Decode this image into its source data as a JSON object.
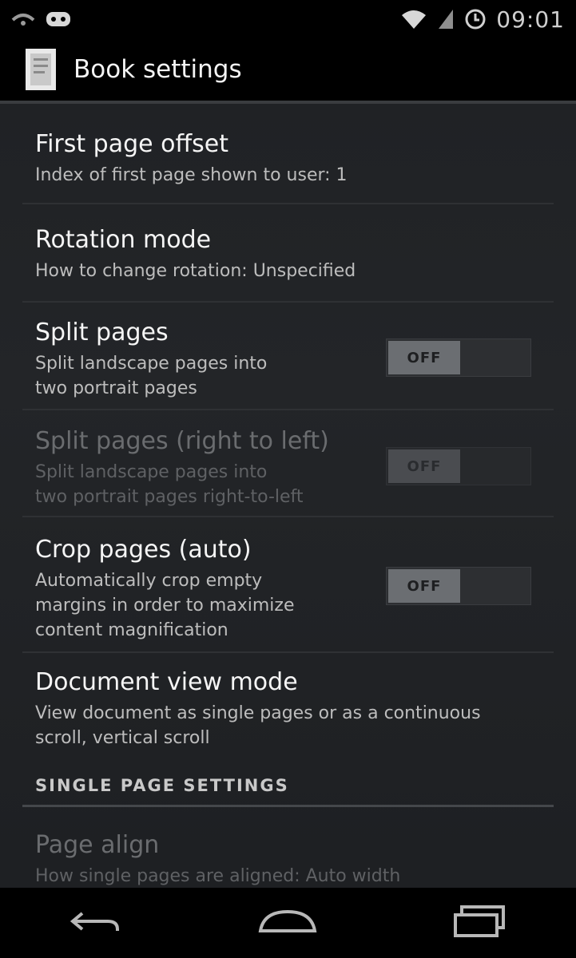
{
  "status_bar": {
    "time": "09:01"
  },
  "action_bar": {
    "title": "Book settings"
  },
  "preferences": [
    {
      "title": "First page offset",
      "summary": "Index of first page shown to user: 1"
    },
    {
      "title": "Rotation mode",
      "summary": "How to change rotation: Unspecified"
    },
    {
      "title": "Split pages",
      "summary": "Split landscape pages into\ntwo portrait pages",
      "switch_label": "OFF"
    },
    {
      "title": "Split pages (right to left)",
      "summary": "Split landscape pages into\ntwo portrait pages right-to-left",
      "switch_label": "OFF"
    },
    {
      "title": "Crop pages (auto)",
      "summary": "Automatically crop empty\nmargins in order to maximize\ncontent magnification",
      "switch_label": "OFF"
    },
    {
      "title": "Document view mode",
      "summary": "View document as single pages or as a continuous\nscroll, vertical scroll"
    },
    {
      "title": "Page align",
      "summary": "How single pages are aligned: Auto width"
    }
  ],
  "category": {
    "label": "SINGLE PAGE SETTINGS"
  },
  "nav_bar": {
    "back": "back-icon",
    "home": "home-icon",
    "recents": "recents-icon"
  }
}
